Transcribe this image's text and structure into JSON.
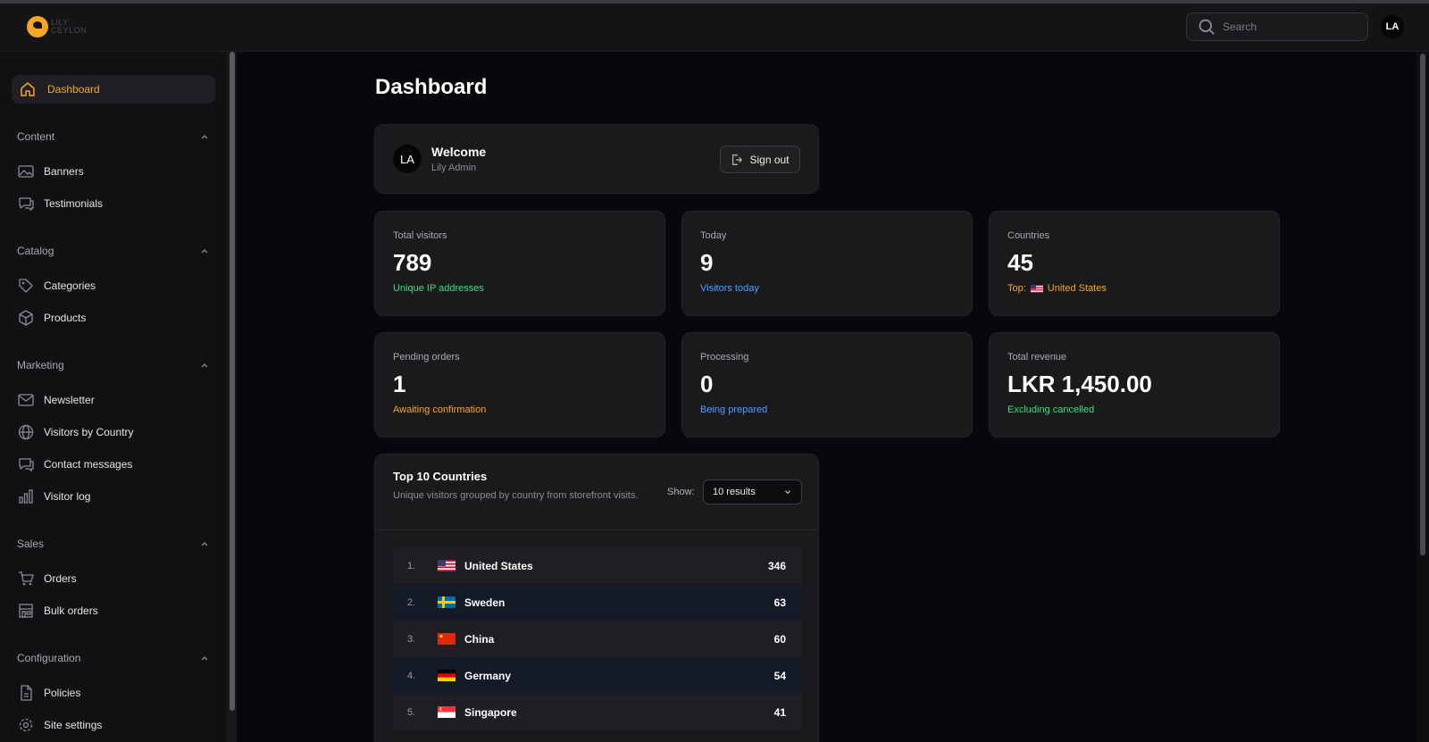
{
  "header": {
    "logo_text_1": "LILY",
    "logo_text_2": "CEYLON",
    "search_placeholder": "Search",
    "avatar": "LA"
  },
  "sidebar": {
    "active": "Dashboard",
    "sections": [
      {
        "title": "Content",
        "items": [
          "Banners",
          "Testimonials"
        ]
      },
      {
        "title": "Catalog",
        "items": [
          "Categories",
          "Products"
        ]
      },
      {
        "title": "Marketing",
        "items": [
          "Newsletter",
          "Visitors by Country",
          "Contact messages",
          "Visitor log"
        ]
      },
      {
        "title": "Sales",
        "items": [
          "Orders",
          "Bulk orders"
        ]
      },
      {
        "title": "Configuration",
        "items": [
          "Policies",
          "Site settings"
        ]
      }
    ]
  },
  "page": {
    "title": "Dashboard"
  },
  "welcome": {
    "avatar": "LA",
    "title": "Welcome",
    "name": "Lily Admin",
    "signout": "Sign out"
  },
  "stats": [
    {
      "label": "Total visitors",
      "value": "789",
      "note": "Unique IP addresses",
      "color": "#3ddc84"
    },
    {
      "label": "Today",
      "value": "9",
      "note": "Visitors today",
      "color": "#4a9eff"
    },
    {
      "label": "Countries",
      "value": "45",
      "note_prefix": "Top:",
      "note": "United States",
      "color": "#f5a623"
    },
    {
      "label": "Pending orders",
      "value": "1",
      "note": "Awaiting confirmation",
      "color": "#f5a623"
    },
    {
      "label": "Processing",
      "value": "0",
      "note": "Being prepared",
      "color": "#4a9eff"
    },
    {
      "label": "Total revenue",
      "value": "LKR 1,450.00",
      "note": "Excluding cancelled",
      "color": "#3ddc84"
    }
  ],
  "countries": {
    "title": "Top 10 Countries",
    "subtitle": "Unique visitors grouped by country from storefront visits.",
    "show_label": "Show:",
    "show_value": "10 results",
    "rows": [
      {
        "rank": "1.",
        "name": "United States",
        "count": "346",
        "flag": "us"
      },
      {
        "rank": "2.",
        "name": "Sweden",
        "count": "63",
        "flag": "se"
      },
      {
        "rank": "3.",
        "name": "China",
        "count": "60",
        "flag": "cn"
      },
      {
        "rank": "4.",
        "name": "Germany",
        "count": "54",
        "flag": "de"
      },
      {
        "rank": "5.",
        "name": "Singapore",
        "count": "41",
        "flag": "sg"
      }
    ]
  },
  "colors": {
    "accent": "#f5a623",
    "green": "#3ddc84",
    "blue": "#4a9eff"
  }
}
